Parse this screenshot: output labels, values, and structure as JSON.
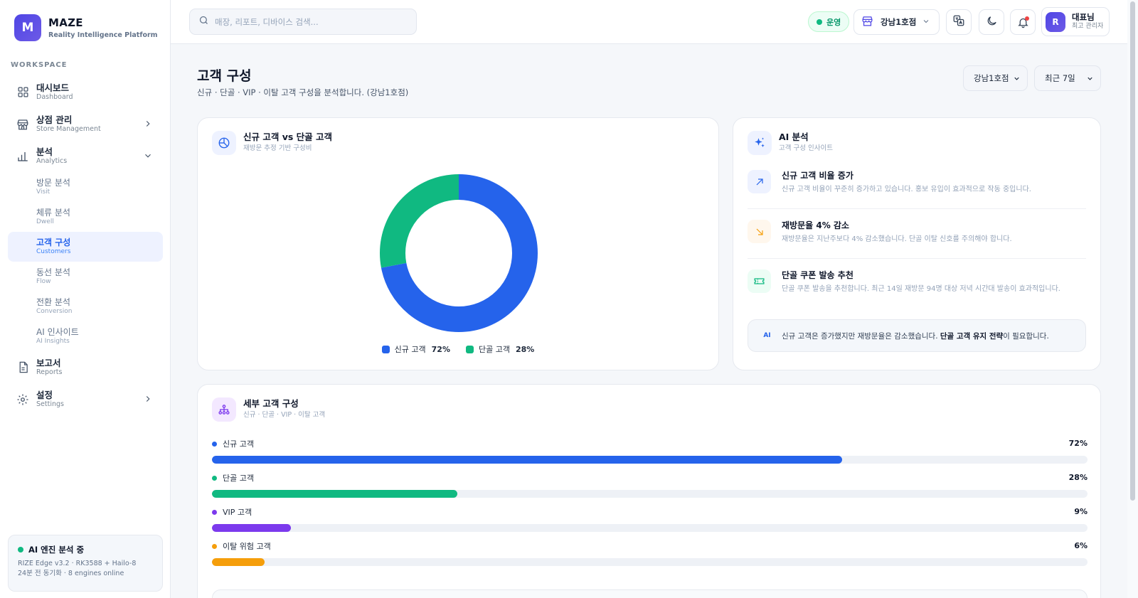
{
  "brand": {
    "logo": "M",
    "name": "MAZE",
    "subtitle": "Reality Intelligence Platform"
  },
  "sidebar": {
    "section_label": "WORKSPACE",
    "items": [
      {
        "ko": "대시보드",
        "en": "Dashboard",
        "icon": "grid-icon"
      },
      {
        "ko": "상점 관리",
        "en": "Store Management",
        "icon": "store-icon"
      },
      {
        "ko": "분석",
        "en": "Analytics",
        "icon": "bar-chart-icon"
      },
      {
        "ko": "보고서",
        "en": "Reports",
        "icon": "document-icon"
      },
      {
        "ko": "설정",
        "en": "Settings",
        "icon": "gear-icon"
      }
    ],
    "analytics_sub": [
      {
        "ko": "방문 분석",
        "en": "Visit"
      },
      {
        "ko": "체류 분석",
        "en": "Dwell"
      },
      {
        "ko": "고객 구성",
        "en": "Customers"
      },
      {
        "ko": "동선 분석",
        "en": "Flow"
      },
      {
        "ko": "전환 분석",
        "en": "Conversion"
      },
      {
        "ko": "AI 인사이트",
        "en": "AI Insights"
      }
    ],
    "active_sub": "고객 구성",
    "engine": {
      "title": "AI 엔진 분석 중",
      "line1": "RIZE Edge v3.2 · RK3588 + Hailo-8",
      "line2": "24분 전 동기화 · 8 engines online"
    }
  },
  "topbar": {
    "search_placeholder": "매장, 리포트, 디바이스 검색...",
    "status": "운영",
    "store": "강남1호점",
    "user_initial": "R",
    "user_name": "대표님",
    "user_role": "최고 관리자"
  },
  "page": {
    "title": "고객 구성",
    "subtitle": "신규 · 단골 · VIP · 이탈 고객 구성을 분석합니다. (강남1호점)",
    "store_select": "강남1호점",
    "period_select": "최근 7일"
  },
  "donut_card": {
    "title": "신규 고객 vs 단골 고객",
    "subtitle": "재방문 추정 기반 구성비",
    "chart_data": {
      "type": "pie",
      "categories": [
        "신규 고객",
        "단골 고객"
      ],
      "values": [
        72,
        28
      ],
      "labels": [
        "72%",
        "28%"
      ],
      "colors": [
        "#2563eb",
        "#10b981"
      ],
      "legend": "bottom"
    }
  },
  "ai_card": {
    "title": "AI 분석",
    "subtitle": "고객 구성 인사이트",
    "insights": [
      {
        "title": "신규 고객 비율 증가",
        "desc": "신규 고객 비율이 꾸준히 증가하고 있습니다. 홍보 유입이 효과적으로 작동 중입니다.",
        "icon": "trend-up-icon",
        "color": "#2563eb"
      },
      {
        "title": "재방문율 4% 감소",
        "desc": "재방문율은 지난주보다 4% 감소했습니다. 단골 이탈 신호를 주의해야 합니다.",
        "icon": "trend-down-icon",
        "color": "#f59e0b"
      },
      {
        "title": "단골 쿠폰 발송 추천",
        "desc": "단골 쿠폰 발송을 추천합니다. 최근 14일 재방문 94명 대상 저녁 시간대 발송이 효과적입니다.",
        "icon": "ticket-icon",
        "color": "#10b981"
      }
    ],
    "summary": {
      "tag": "AI",
      "pre": "신규 고객은 증가했지만 재방문율은 감소했습니다. ",
      "bold": "단골 고객 유지 전략",
      "post": "이 필요합니다."
    }
  },
  "breakdown_card": {
    "title": "세부 고객 구성",
    "subtitle": "신규 · 단골 · VIP · 이탈 고객",
    "chart_data": {
      "type": "bar",
      "categories": [
        "신규 고객",
        "단골 고객",
        "VIP 고객",
        "이탈 위험 고객"
      ],
      "values": [
        72,
        28,
        9,
        6
      ],
      "labels": [
        "72%",
        "28%",
        "9%",
        "6%"
      ],
      "colors": [
        "#2563eb",
        "#10b981",
        "#7c3aed",
        "#f59e0b"
      ],
      "ylim": [
        0,
        100
      ]
    }
  }
}
